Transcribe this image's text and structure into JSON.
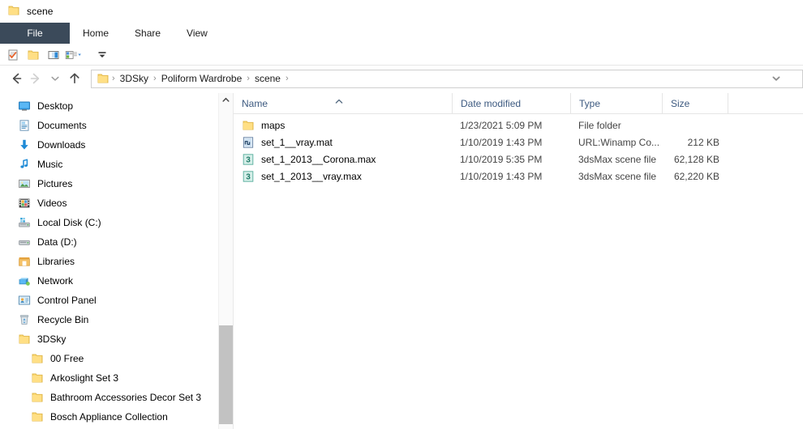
{
  "window": {
    "title": "scene",
    "title_icon": "folder-icon"
  },
  "ribbon": {
    "tabs": [
      {
        "label": "File",
        "active": true
      },
      {
        "label": "Home",
        "active": false
      },
      {
        "label": "Share",
        "active": false
      },
      {
        "label": "View",
        "active": false
      }
    ]
  },
  "quick_access": {
    "items": [
      {
        "icon": "properties-icon",
        "label": "Properties"
      },
      {
        "icon": "new-folder-icon",
        "label": "New folder"
      },
      {
        "icon": "panes-icon",
        "label": "Panes"
      },
      {
        "icon": "customize-toolbar-icon",
        "label": "Customize Quick Access Toolbar"
      }
    ],
    "minimize_ribbon_icon": "chevron-collapse-icon"
  },
  "navigation": {
    "back": {
      "icon": "back-arrow-icon",
      "enabled": true
    },
    "forward": {
      "icon": "forward-arrow-icon",
      "enabled": false
    },
    "recent": {
      "icon": "chevron-down-icon",
      "enabled": true
    },
    "up": {
      "icon": "up-arrow-icon",
      "enabled": true
    },
    "address_dropdown_icon": "chevron-down-icon"
  },
  "breadcrumb": {
    "leading_icon": "folder-icon",
    "separator": "›",
    "items": [
      "3DSky",
      "Poliform Wardrobe",
      "scene"
    ]
  },
  "sidebar": {
    "items": [
      {
        "label": "Desktop",
        "icon": "desktop-icon",
        "indent": 0
      },
      {
        "label": "Documents",
        "icon": "documents-icon",
        "indent": 0
      },
      {
        "label": "Downloads",
        "icon": "downloads-icon",
        "indent": 0
      },
      {
        "label": "Music",
        "icon": "music-icon",
        "indent": 0
      },
      {
        "label": "Pictures",
        "icon": "pictures-icon",
        "indent": 0
      },
      {
        "label": "Videos",
        "icon": "videos-icon",
        "indent": 0
      },
      {
        "label": "Local Disk (C:)",
        "icon": "local-disk-icon",
        "indent": 0
      },
      {
        "label": "Data (D:)",
        "icon": "drive-icon",
        "indent": 0
      },
      {
        "label": "Libraries",
        "icon": "libraries-icon",
        "indent": 0
      },
      {
        "label": "Network",
        "icon": "network-icon",
        "indent": 0
      },
      {
        "label": "Control Panel",
        "icon": "control-panel-icon",
        "indent": 0
      },
      {
        "label": "Recycle Bin",
        "icon": "recycle-bin-icon",
        "indent": 0
      },
      {
        "label": "3DSky",
        "icon": "folder-icon",
        "indent": 0
      },
      {
        "label": "00 Free",
        "icon": "folder-icon",
        "indent": 1
      },
      {
        "label": "Arkoslight Set 3",
        "icon": "folder-icon",
        "indent": 1
      },
      {
        "label": "Bathroom Accessories Decor Set 3",
        "icon": "folder-icon",
        "indent": 1
      },
      {
        "label": "Bosch Appliance Collection",
        "icon": "folder-icon",
        "indent": 1
      }
    ],
    "scroll_up_icon": "scroll-up-arrow-icon"
  },
  "file_list": {
    "columns": [
      {
        "label": "Name",
        "sorted": "asc"
      },
      {
        "label": "Date modified",
        "sorted": null
      },
      {
        "label": "Type",
        "sorted": null
      },
      {
        "label": "Size",
        "sorted": null
      }
    ],
    "rows": [
      {
        "icon": "folder-icon",
        "name": "maps",
        "date_modified": "1/23/2021 5:09 PM",
        "type": "File folder",
        "size": ""
      },
      {
        "icon": "mat-file-icon",
        "name": "set_1__vray.mat",
        "date_modified": "1/10/2019 1:43 PM",
        "type": "URL:Winamp Co...",
        "size": "212 KB"
      },
      {
        "icon": "max-file-icon",
        "name": "set_1_2013__Corona.max",
        "date_modified": "1/10/2019 5:35 PM",
        "type": "3dsMax scene file",
        "size": "62,128 KB"
      },
      {
        "icon": "max-file-icon",
        "name": "set_1_2013__vray.max",
        "date_modified": "1/10/2019 1:43 PM",
        "type": "3dsMax scene file",
        "size": "62,220 KB"
      }
    ]
  },
  "colors": {
    "file_tab_background": "#3b4a5a",
    "folder_yellow": "#ffd966",
    "accent_blue": "#0078d7",
    "column_header_text": "#3d5a80",
    "hover_blue": "#e5f3fb"
  }
}
